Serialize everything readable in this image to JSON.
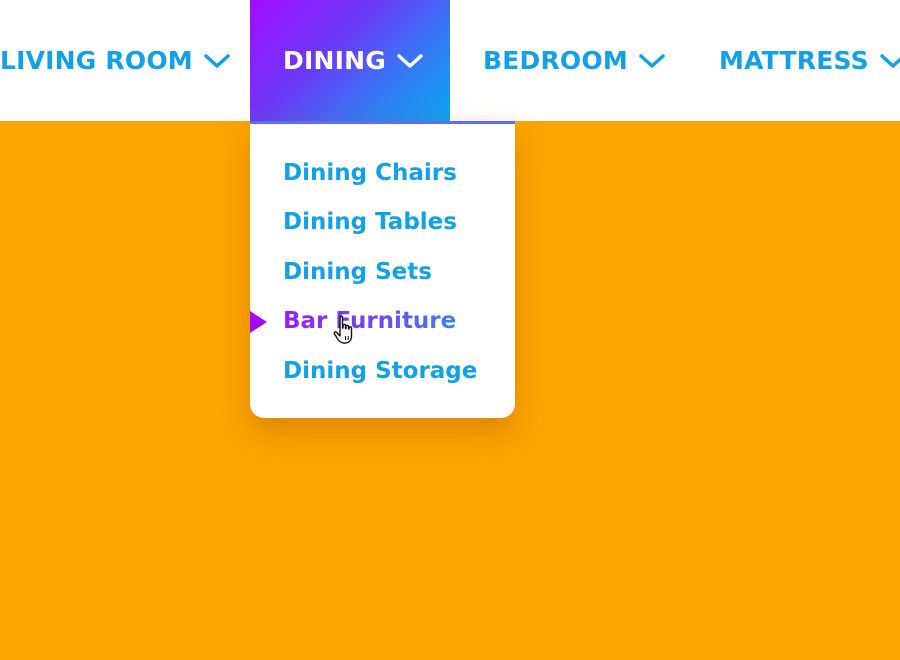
{
  "nav": {
    "items": [
      {
        "label": "LIVING ROOM",
        "icon": "chevron-down-icon"
      },
      {
        "label": "DINING",
        "icon": "chevron-down-icon",
        "active": true
      },
      {
        "label": "BEDROOM",
        "icon": "chevron-down-icon"
      },
      {
        "label": "MATTRESS",
        "icon": "chevron-down-icon"
      }
    ]
  },
  "dropdown": {
    "items": [
      {
        "label": "Dining Chairs"
      },
      {
        "label": "Dining Tables"
      },
      {
        "label": "Dining Sets"
      },
      {
        "label": "Bar Furniture",
        "hovered": true
      },
      {
        "label": "Dining Storage"
      }
    ]
  },
  "colors": {
    "page_background": "#fea500",
    "nav_text": "#12a0e6",
    "active_gradient_start": "#a30bff",
    "active_gradient_end": "#0aa6f0",
    "hover_marker": "#a10cf6"
  },
  "icons": {
    "chevron": "chevron-down-icon",
    "cursor": "hand-pointer-cursor-icon",
    "marker": "triangle-right-icon"
  }
}
